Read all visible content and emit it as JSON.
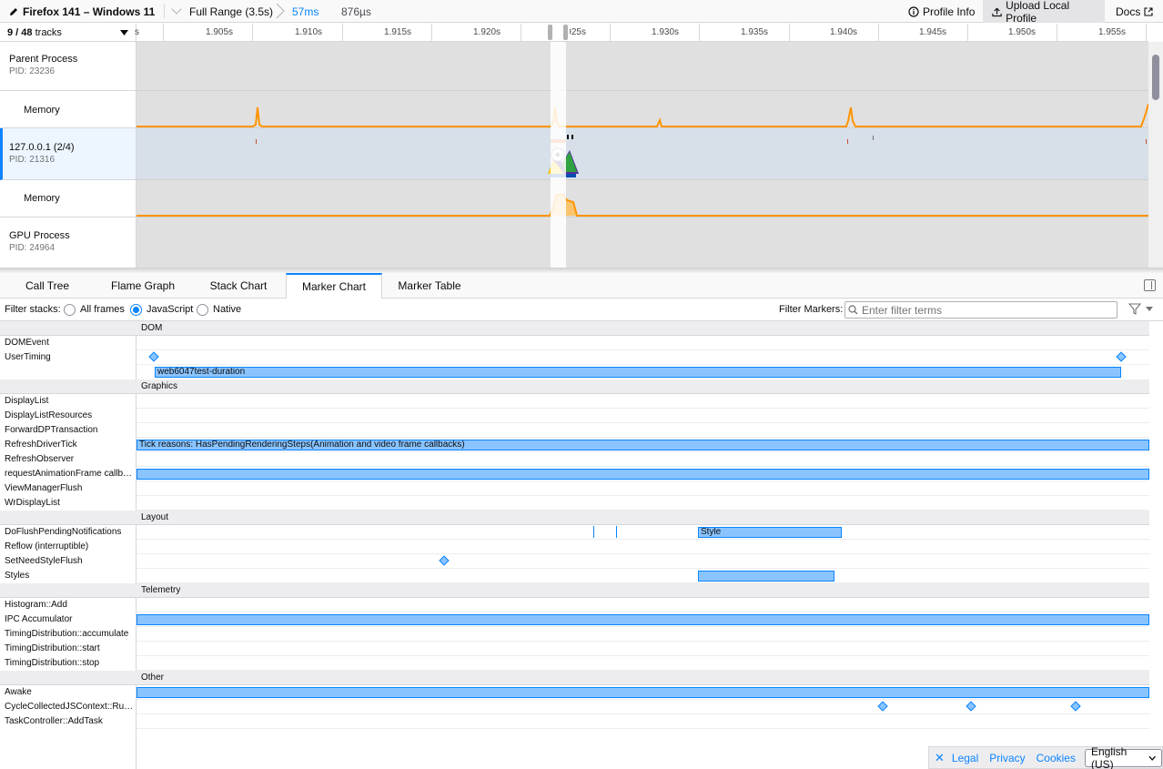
{
  "topbar": {
    "title": "Firefox 141 – Windows 11",
    "range": "Full Range (3.5s)",
    "sub_range_1": "57ms",
    "sub_range_2": "876µs",
    "profile_info": "Profile Info",
    "upload": "Upload Local Profile",
    "docs": "Docs"
  },
  "timeline": {
    "tracks_count": "9 / 48",
    "tracks_word": "tracks",
    "ticks": [
      "1.905s",
      "1.910s",
      "1.915s",
      "1.920s",
      "1.925s",
      "1.930s",
      "1.935s",
      "1.940s",
      "1.945s",
      "1.950s",
      "1.955s"
    ],
    "tracks": [
      {
        "name": "Parent Process",
        "pid": "PID: 23236"
      },
      {
        "name": "Memory",
        "pid": ""
      },
      {
        "name": "127.0.0.1 (2/4)",
        "pid": "PID: 21316"
      },
      {
        "name": "Memory",
        "pid": ""
      },
      {
        "name": "GPU Process",
        "pid": "PID: 24964"
      }
    ],
    "memory_color": "#ff9400",
    "selected_track_color": "#0a84ff"
  },
  "tabs": [
    "Call Tree",
    "Flame Graph",
    "Stack Chart",
    "Marker Chart",
    "Marker Table"
  ],
  "selected_tab": "Marker Chart",
  "filters": {
    "filter_stacks_label": "Filter stacks:",
    "options": [
      "All frames",
      "JavaScript",
      "Native"
    ],
    "selected": "JavaScript",
    "filter_markers_label": "Filter Markers:",
    "search_placeholder": "Enter filter terms"
  },
  "marker_chart": {
    "categories": [
      {
        "name": "DOM",
        "rows": [
          "DOMEvent",
          "UserTiming"
        ]
      },
      {
        "name": "Graphics",
        "rows": [
          "DisplayList",
          "DisplayListResources",
          "ForwardDPTransaction",
          "RefreshDriverTick",
          "RefreshObserver",
          "requestAnimationFrame callb…",
          "ViewManagerFlush",
          "WrDisplayList"
        ]
      },
      {
        "name": "Layout",
        "rows": [
          "DoFlushPendingNotifications",
          "Reflow (interruptible)",
          "SetNeedStyleFlush",
          "Styles"
        ]
      },
      {
        "name": "Telemetry",
        "rows": [
          "Histogram::Add",
          "IPC Accumulator",
          "TimingDistribution::accumulate",
          "TimingDistribution::start",
          "TimingDistribution::stop"
        ]
      },
      {
        "name": "Other",
        "rows": [
          "Awake",
          "CycleCollectedJSContext::Ru…",
          "TaskController::AddTask"
        ]
      }
    ],
    "bar_labels": {
      "usertiming": "web6047test-duration",
      "refresh_tick": "Tick reasons: HasPendingRenderingSteps(Animation and video frame callbacks)",
      "style": "Style"
    },
    "marker_color": "#8ac4ff"
  },
  "footer": {
    "legal": "Legal",
    "privacy": "Privacy",
    "cookies": "Cookies",
    "language": "English (US)"
  }
}
